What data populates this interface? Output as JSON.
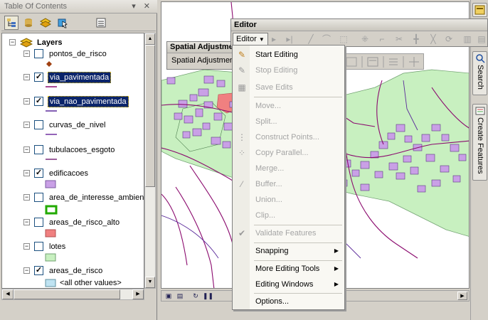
{
  "toc": {
    "title": "Table Of Contents",
    "title_controls": "▾ ✕",
    "root_label": "Layers",
    "layers": [
      {
        "name": "pontos_de_risco",
        "checked": false,
        "selected": false
      },
      {
        "name": "via_pavimentada",
        "checked": true,
        "selected": true
      },
      {
        "name": "via_nao_pavimentada",
        "checked": true,
        "selected": true
      },
      {
        "name": "curvas_de_nivel",
        "checked": false,
        "selected": false
      },
      {
        "name": "tubulacoes_esgoto",
        "checked": false,
        "selected": false
      },
      {
        "name": "edificacoes",
        "checked": true,
        "selected": false
      },
      {
        "name": "area_de_interesse_ambient",
        "checked": false,
        "selected": false
      },
      {
        "name": "areas_de_risco_alto",
        "checked": false,
        "selected": false
      },
      {
        "name": "lotes",
        "checked": false,
        "selected": false
      },
      {
        "name": "areas_de_risco",
        "checked": true,
        "selected": false
      }
    ],
    "other_values_label": "<all other values>"
  },
  "spatial_adjustment": {
    "title": "Spatial Adjustment",
    "menu_label": "Spatial Adjustment"
  },
  "editor": {
    "title": "Editor",
    "dropdown_label": "Editor",
    "menu": {
      "start_editing": "Start Editing",
      "stop_editing": "Stop Editing",
      "save_edits": "Save Edits",
      "move": "Move...",
      "split": "Split...",
      "construct_points": "Construct Points...",
      "copy_parallel": "Copy Parallel...",
      "merge": "Merge...",
      "buffer": "Buffer...",
      "union": "Union...",
      "clip": "Clip...",
      "validate_features": "Validate Features",
      "snapping": "Snapping",
      "more_editing_tools": "More Editing Tools",
      "editing_windows": "Editing Windows",
      "options": "Options..."
    }
  },
  "right_dock": {
    "search_label": "Search",
    "create_features_label": "Create Features"
  },
  "colors": {
    "edificacoes_fill": "#c9a0e6",
    "area_interesse_outline": "#22aa00",
    "areas_risco_alto_fill": "#f08080",
    "lotes_fill": "#c8f0c0",
    "areas_risco_fill": "#bfe3f2",
    "selection_blue": "#0a246a",
    "road_line": "#8b0a6e"
  }
}
